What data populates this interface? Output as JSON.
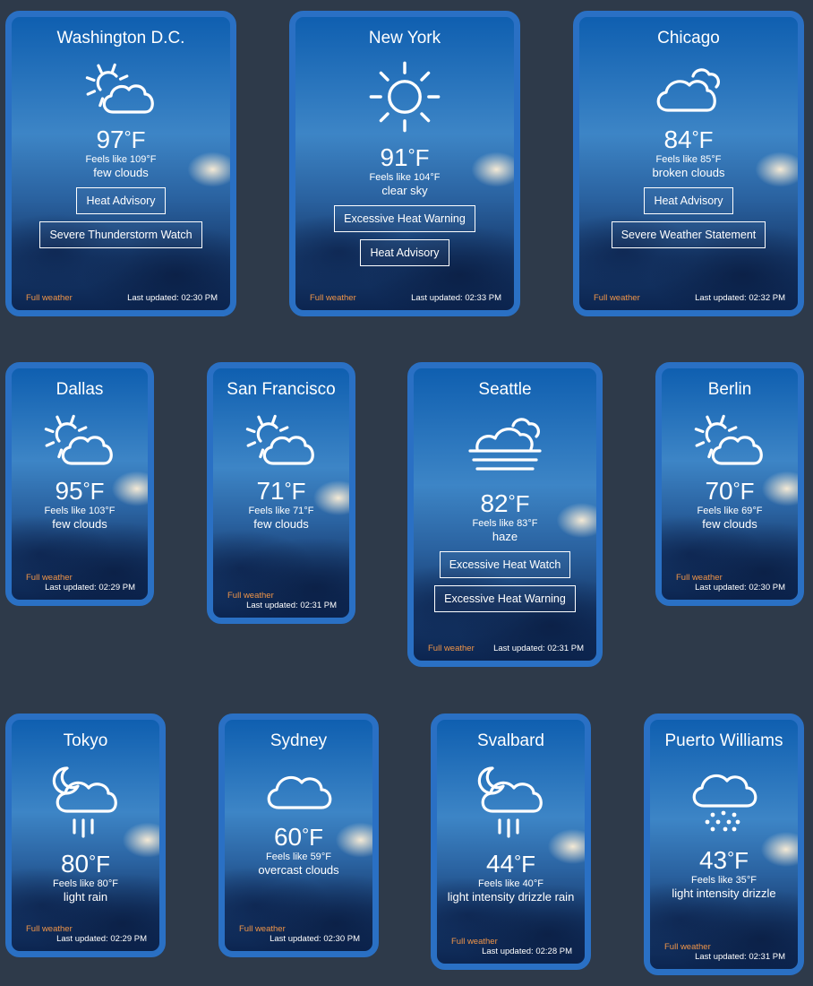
{
  "footer": {
    "full_weather": "Full weather",
    "last_updated_prefix": "Last updated: "
  },
  "colors": {
    "card_border": "#2a70c4",
    "background": "#2e3a4a",
    "link": "#f09548"
  },
  "cards": [
    {
      "city": "Washington D.C.",
      "icon": "sun-behind-cloud-icon",
      "temp": "97",
      "feels": "Feels like 109",
      "condition": "few clouds",
      "alerts": [
        "Heat Advisory",
        "Severe Thunderstorm Watch"
      ],
      "updated": "Last updated: 02:30 PM"
    },
    {
      "city": "New York",
      "icon": "sun-icon",
      "temp": "91",
      "feels": "Feels like 104",
      "condition": "clear sky",
      "alerts": [
        "Excessive Heat Warning",
        "Heat Advisory"
      ],
      "updated": "Last updated: 02:33 PM"
    },
    {
      "city": "Chicago",
      "icon": "broken-clouds-icon",
      "temp": "84",
      "feels": "Feels like 85",
      "condition": "broken clouds",
      "alerts": [
        "Heat Advisory",
        "Severe Weather Statement"
      ],
      "updated": "Last updated: 02:32 PM"
    },
    {
      "city": "Dallas",
      "icon": "sun-behind-cloud-icon",
      "temp": "95",
      "feels": "Feels like 103",
      "condition": "few clouds",
      "alerts": [],
      "updated": "Last updated: 02:29 PM"
    },
    {
      "city": "San Francisco",
      "icon": "sun-behind-cloud-icon",
      "temp": "71",
      "feels": "Feels like 71",
      "condition": "few clouds",
      "alerts": [],
      "updated": "Last updated: 02:31 PM"
    },
    {
      "city": "Seattle",
      "icon": "haze-icon",
      "temp": "82",
      "feels": "Feels like 83",
      "condition": "haze",
      "alerts": [
        "Excessive Heat Watch",
        "Excessive Heat Warning"
      ],
      "updated": "Last updated: 02:31 PM"
    },
    {
      "city": "Berlin",
      "icon": "sun-behind-cloud-icon",
      "temp": "70",
      "feels": "Feels like 69",
      "condition": "few clouds",
      "alerts": [],
      "updated": "Last updated: 02:30 PM"
    },
    {
      "city": "Tokyo",
      "icon": "moon-cloud-rain-icon",
      "temp": "80",
      "feels": "Feels like 80",
      "condition": "light rain",
      "alerts": [],
      "updated": "Last updated: 02:29 PM"
    },
    {
      "city": "Sydney",
      "icon": "cloud-icon",
      "temp": "60",
      "feels": "Feels like 59",
      "condition": "overcast clouds",
      "alerts": [],
      "updated": "Last updated: 02:30 PM"
    },
    {
      "city": "Svalbard",
      "icon": "moon-cloud-rain-icon",
      "temp": "44",
      "feels": "Feels like 40",
      "condition": "light intensity drizzle rain",
      "alerts": [],
      "updated": "Last updated: 02:28 PM"
    },
    {
      "city": "Puerto Williams",
      "icon": "cloud-drizzle-icon",
      "temp": "43",
      "feels": "Feels like 35",
      "condition": "light intensity drizzle",
      "alerts": [],
      "updated": "Last updated: 02:31 PM"
    }
  ]
}
